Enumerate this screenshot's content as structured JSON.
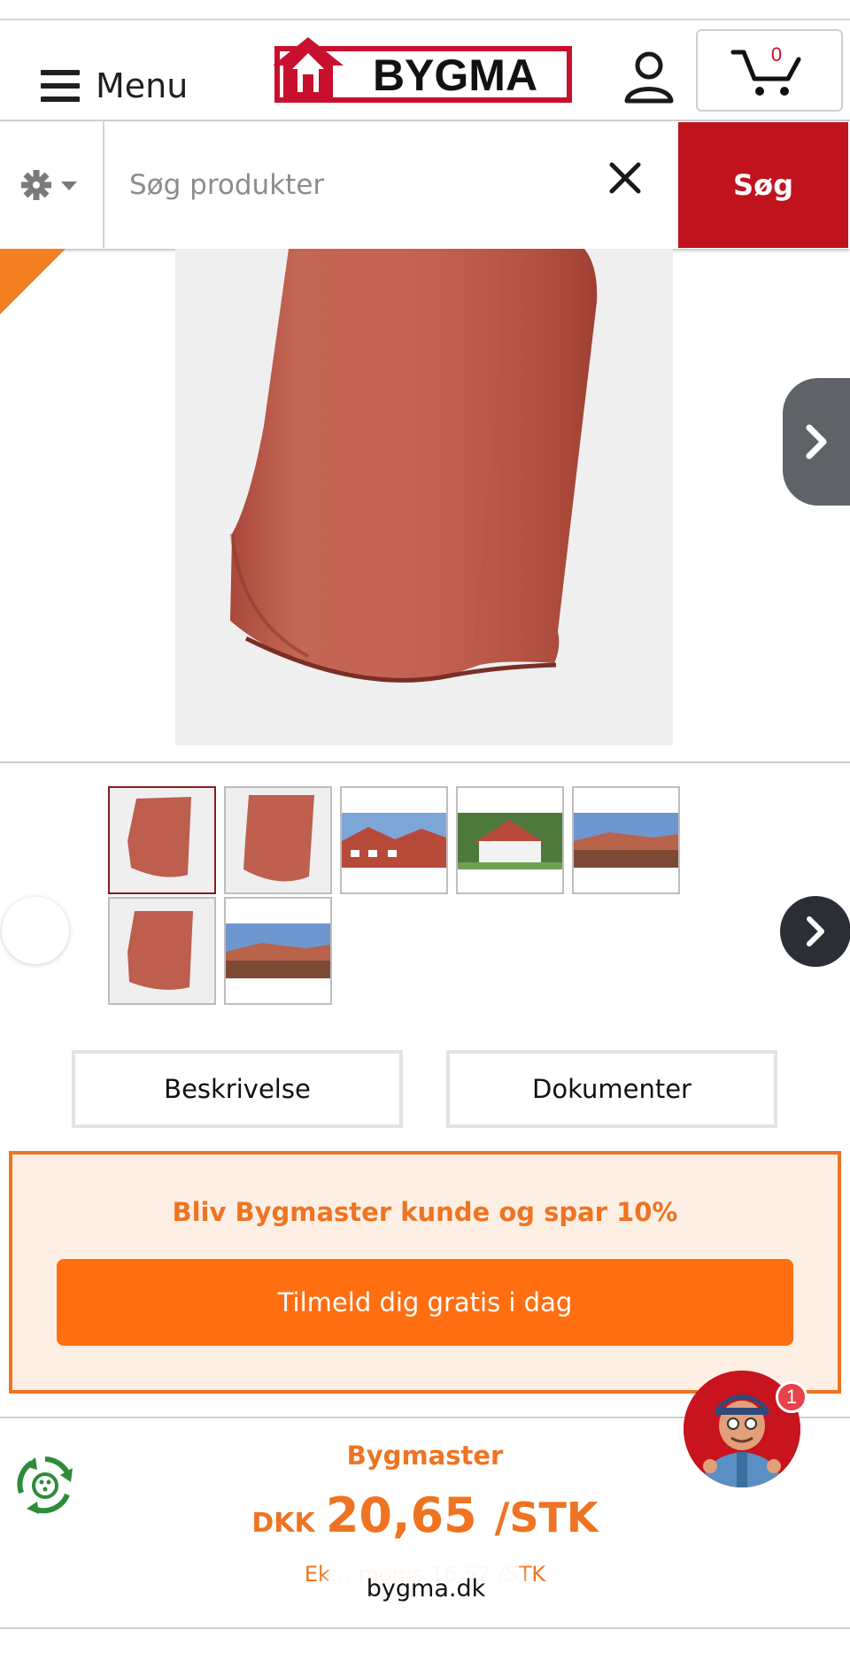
{
  "header": {
    "menu_label": "Menu",
    "logo_text": "BYGMA",
    "cart_count": "0",
    "user_icon": "user-icon",
    "cart_icon": "cart-icon"
  },
  "search": {
    "placeholder": "Søg produkter",
    "button_label": "Søg",
    "filter_icon": "gear-icon",
    "clear_icon": "close-icon"
  },
  "tabs": [
    {
      "label": "Beskrivelse"
    },
    {
      "label": "Dokumenter"
    }
  ],
  "promo": {
    "title": "Bliv Bygmaster kunde og spar 10%",
    "button_label": "Tilmeld dig gratis i dag"
  },
  "price": {
    "label": "Bygmaster",
    "currency": "DKK",
    "value": "20,65",
    "unit": "/STK",
    "ex_vat_text": "Ek… moms 16,52 /STK"
  },
  "chat": {
    "badge_count": "1"
  },
  "browser": {
    "url": "bygma.dk"
  },
  "colors": {
    "brand_red": "#c0131e",
    "accent_orange": "#ef7422",
    "promo_bg": "#fdefe4"
  }
}
